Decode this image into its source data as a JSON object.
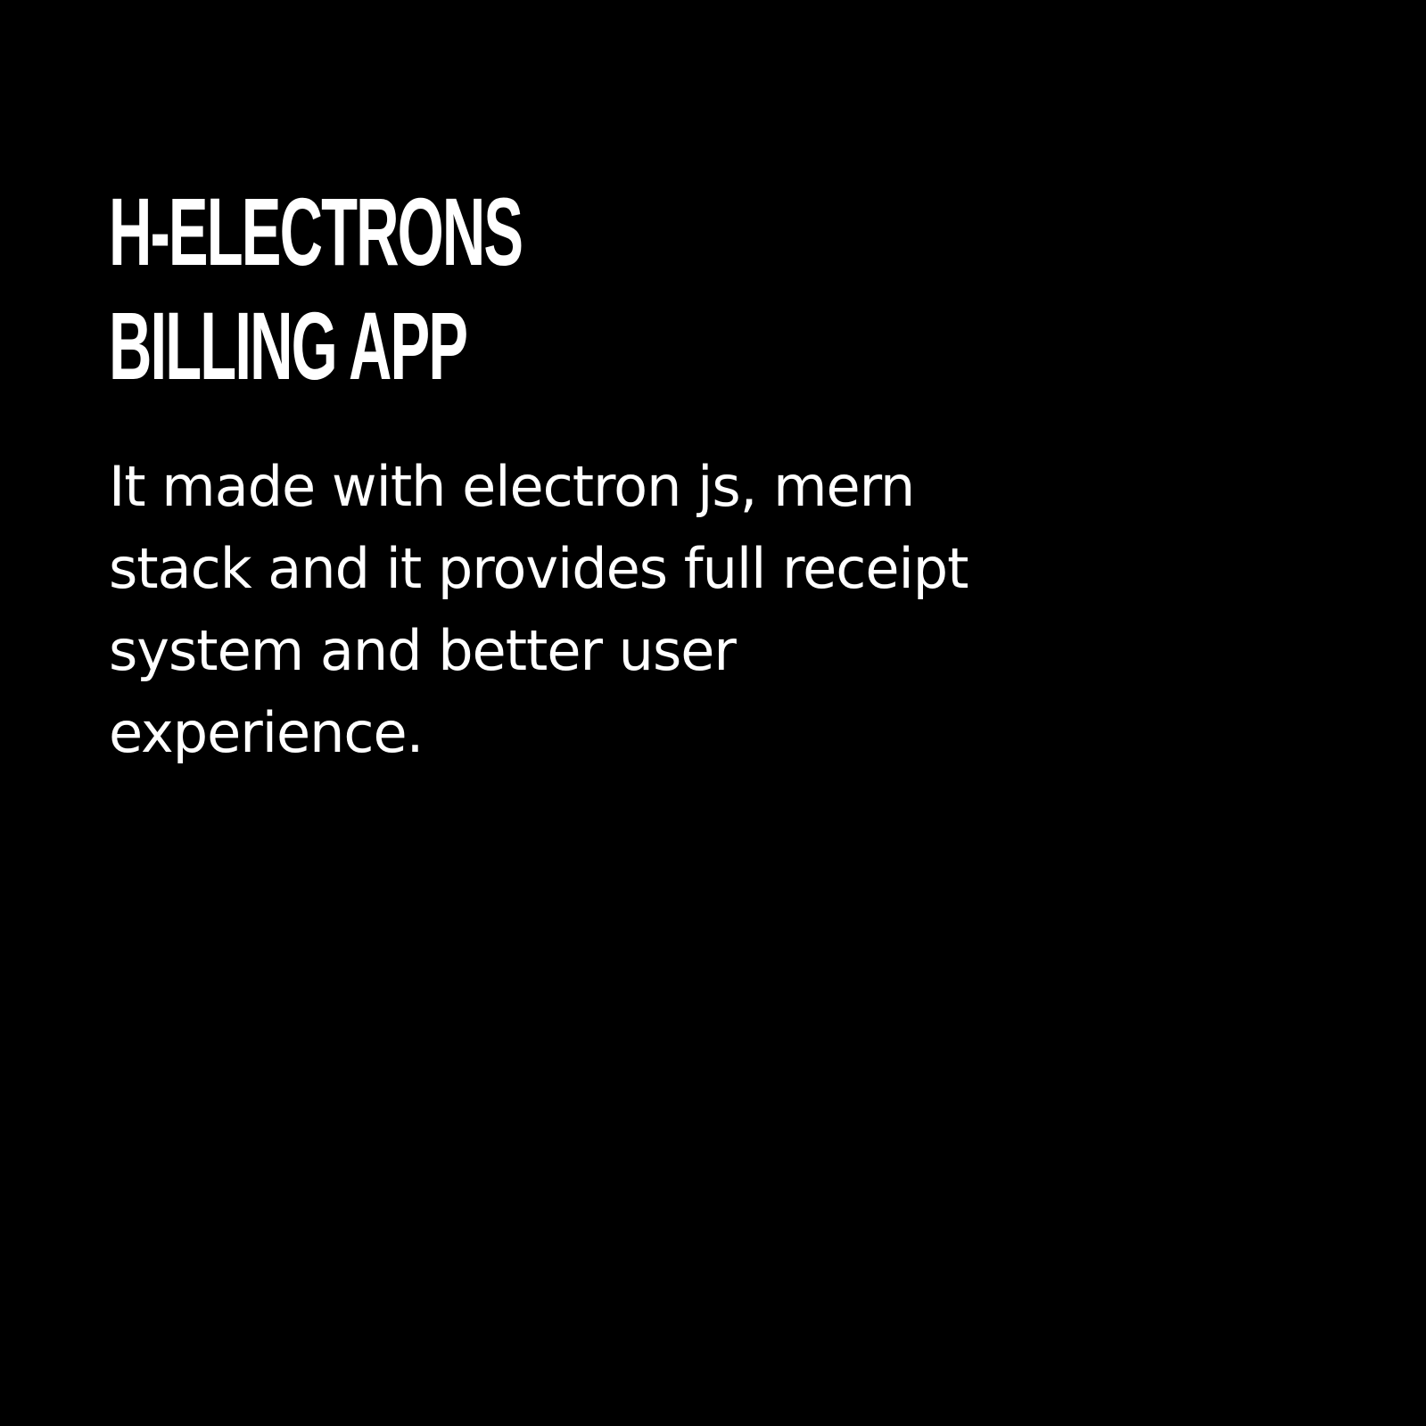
{
  "title": {
    "line1": "H-ELECTRONS",
    "line2": "BILLING APP"
  },
  "description": "It made with electron js, mern stack and it provides full receipt system and better user experience.",
  "colors": {
    "background": "#000000",
    "text": "#ffffff"
  }
}
